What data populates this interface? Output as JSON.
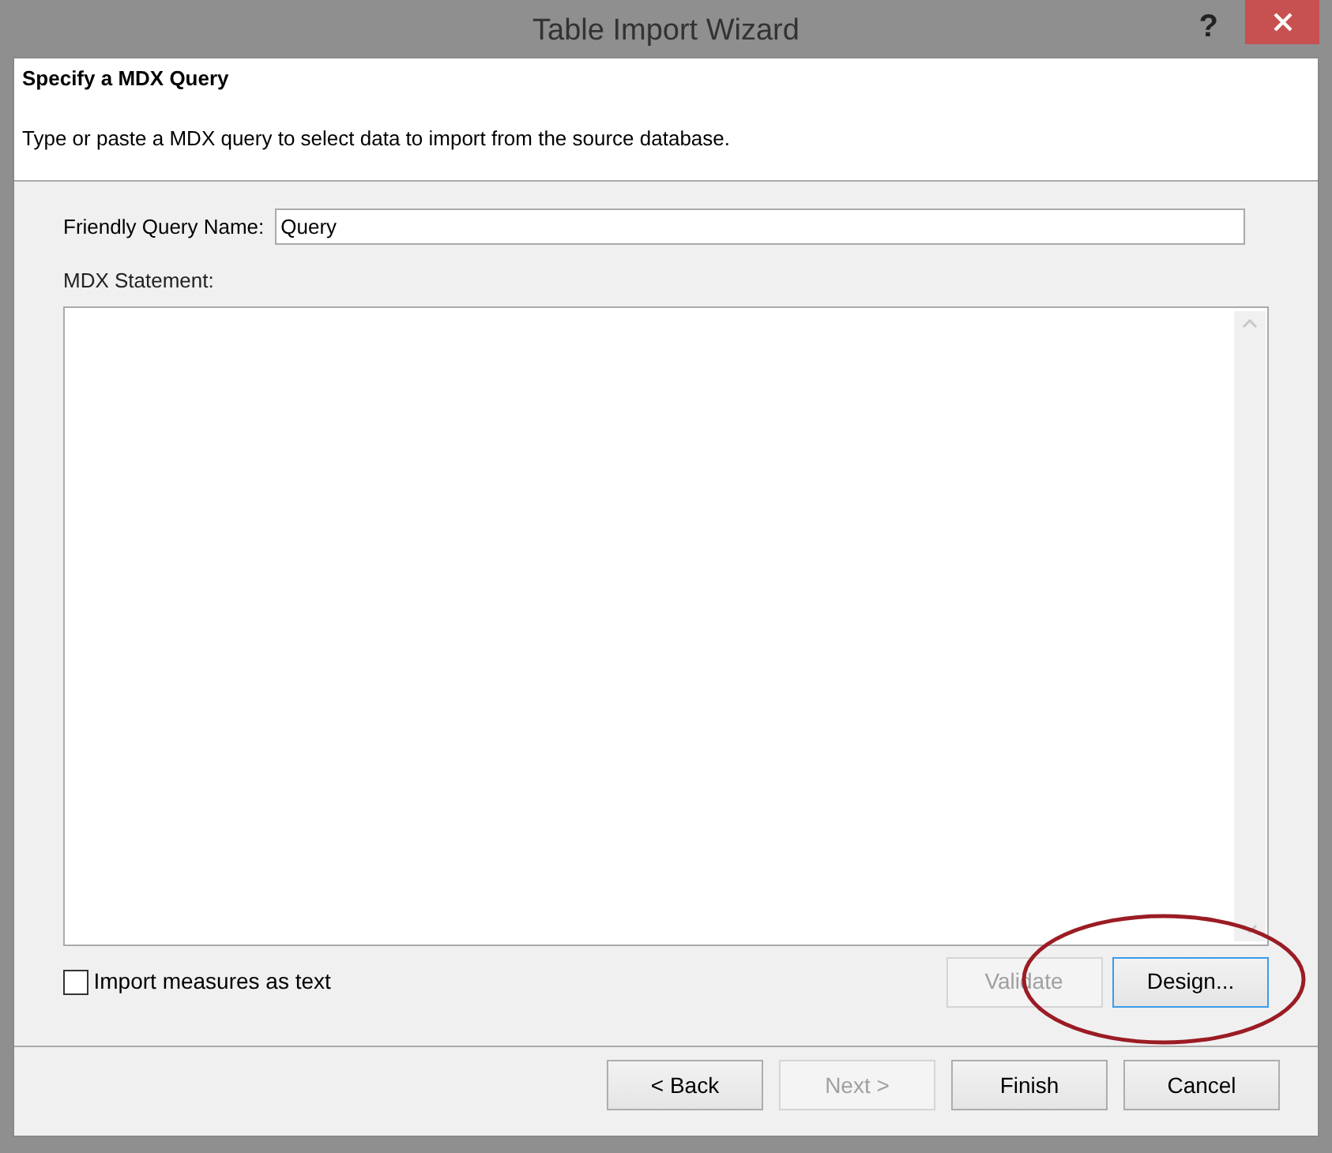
{
  "window": {
    "title": "Table Import Wizard",
    "help": "?"
  },
  "header": {
    "title": "Specify a MDX Query",
    "description": "Type or paste a MDX query to select data to import from the source database."
  },
  "query_name": {
    "label": "Friendly Query Name:",
    "value": "Query"
  },
  "statement": {
    "label": "MDX Statement:"
  },
  "import_as_text": {
    "label": "Import measures as text",
    "checked": false
  },
  "query_buttons": [
    {
      "label": "Validate",
      "disabled": true,
      "focused": false,
      "highlighted": false
    },
    {
      "label": "Design...",
      "disabled": false,
      "focused": true,
      "highlighted": true
    }
  ],
  "nav_buttons": [
    {
      "label": "< Back",
      "disabled": false
    },
    {
      "label": "Next >",
      "disabled": true
    },
    {
      "label": "Finish",
      "disabled": false
    },
    {
      "label": "Cancel",
      "disabled": false
    }
  ]
}
